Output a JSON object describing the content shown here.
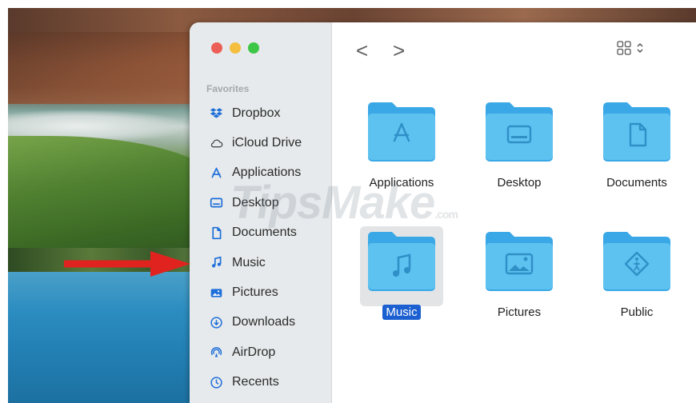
{
  "sidebar": {
    "heading": "Favorites",
    "items": [
      {
        "label": "Dropbox",
        "icon": "dropbox-icon"
      },
      {
        "label": "iCloud Drive",
        "icon": "cloud-icon"
      },
      {
        "label": "Applications",
        "icon": "applications-icon"
      },
      {
        "label": "Desktop",
        "icon": "desktop-icon"
      },
      {
        "label": "Documents",
        "icon": "document-icon"
      },
      {
        "label": "Music",
        "icon": "music-note-icon"
      },
      {
        "label": "Pictures",
        "icon": "picture-icon"
      },
      {
        "label": "Downloads",
        "icon": "download-icon"
      },
      {
        "label": "AirDrop",
        "icon": "airdrop-icon"
      },
      {
        "label": "Recents",
        "icon": "clock-icon"
      }
    ]
  },
  "toolbar": {
    "back": "<",
    "forward": ">"
  },
  "folders": [
    {
      "label": "Applications",
      "icon": "applications-icon",
      "selected": false
    },
    {
      "label": "Desktop",
      "icon": "desktop-icon",
      "selected": false
    },
    {
      "label": "Documents",
      "icon": "document-icon",
      "selected": false
    },
    {
      "label": "Music",
      "icon": "music-note-icon",
      "selected": true
    },
    {
      "label": "Pictures",
      "icon": "picture-icon",
      "selected": false
    },
    {
      "label": "Public",
      "icon": "public-icon",
      "selected": false
    }
  ],
  "watermark": {
    "main": "TipsMake",
    "suffix": ".com"
  },
  "colors": {
    "accent": "#1b5fd1",
    "folder": "#5ec2f0",
    "sidebar_icon": "#1e6fd9",
    "arrow": "#e1231f"
  }
}
